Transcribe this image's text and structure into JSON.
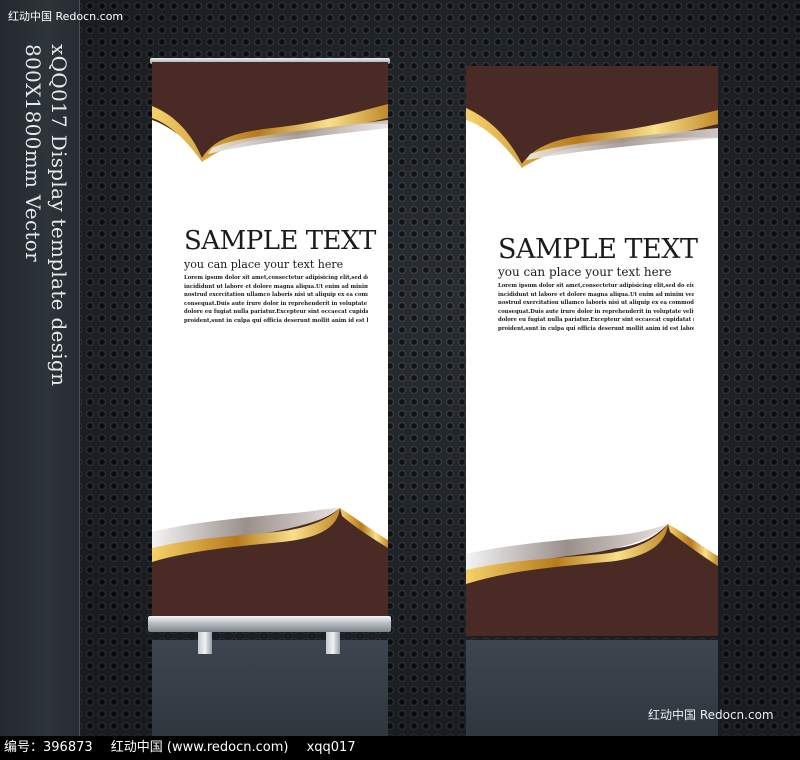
{
  "watermark_top": "红动中国 Redocn.com",
  "watermark_bottom": "红动中国 Redocn.com",
  "side_text": [
    "xQQ017 Display template design",
    "800X1800mm Vector"
  ],
  "banners": [
    {
      "title": "SAMPLE TEXT",
      "subtitle": "you can place your text here",
      "body": [
        "Lorem ipsum dolor sit amet,consectetur adipisicing elit,sed do eiusmod tempor",
        "incididunt ut labore et dolore magna aliqua.Ut enim ad minim veniam,quis",
        "nostrud exercitation ullamco laboris nisi ut aliquip ex ea commodo",
        "consequat.Duis aute irure dolor in reprehenderit in voluptate velit esse cillum",
        "dolore eu fugiat nulla pariatur.Excepteur sint occaecat cupidatat non",
        "proident,sunt in culpa qui officia deserunt mollit anim id est laborum"
      ]
    },
    {
      "title": "SAMPLE TEXT",
      "subtitle": "you can place your text here",
      "body": [
        "Lorem ipsum dolor sit amet,consectetur adipisicing elit,sed do eiusmod tempor",
        "incididunt ut labore et dolore magna aliqua.Ut enim ad minim veniam,quis",
        "nostrud exercitation ullamco laboris nisi ut aliquip ex ea commodo",
        "consequat.Duis aute irure dolor in reprehenderit in voluptate velit esse cillum",
        "dolore eu fugiat nulla pariatur.Excepteur sint occaecat cupidatat non",
        "proident,sunt in culpa qui officia deserunt mollit anim id est laborum"
      ]
    }
  ],
  "footer": {
    "id_text": "编号：396873",
    "site_text": "红动中国 (www.redocn.com)",
    "code_text": "xqq017"
  },
  "colors": {
    "banner_brown": "#4a2a25",
    "gold": "#d8a63a",
    "silver": "#c9c9c9"
  }
}
